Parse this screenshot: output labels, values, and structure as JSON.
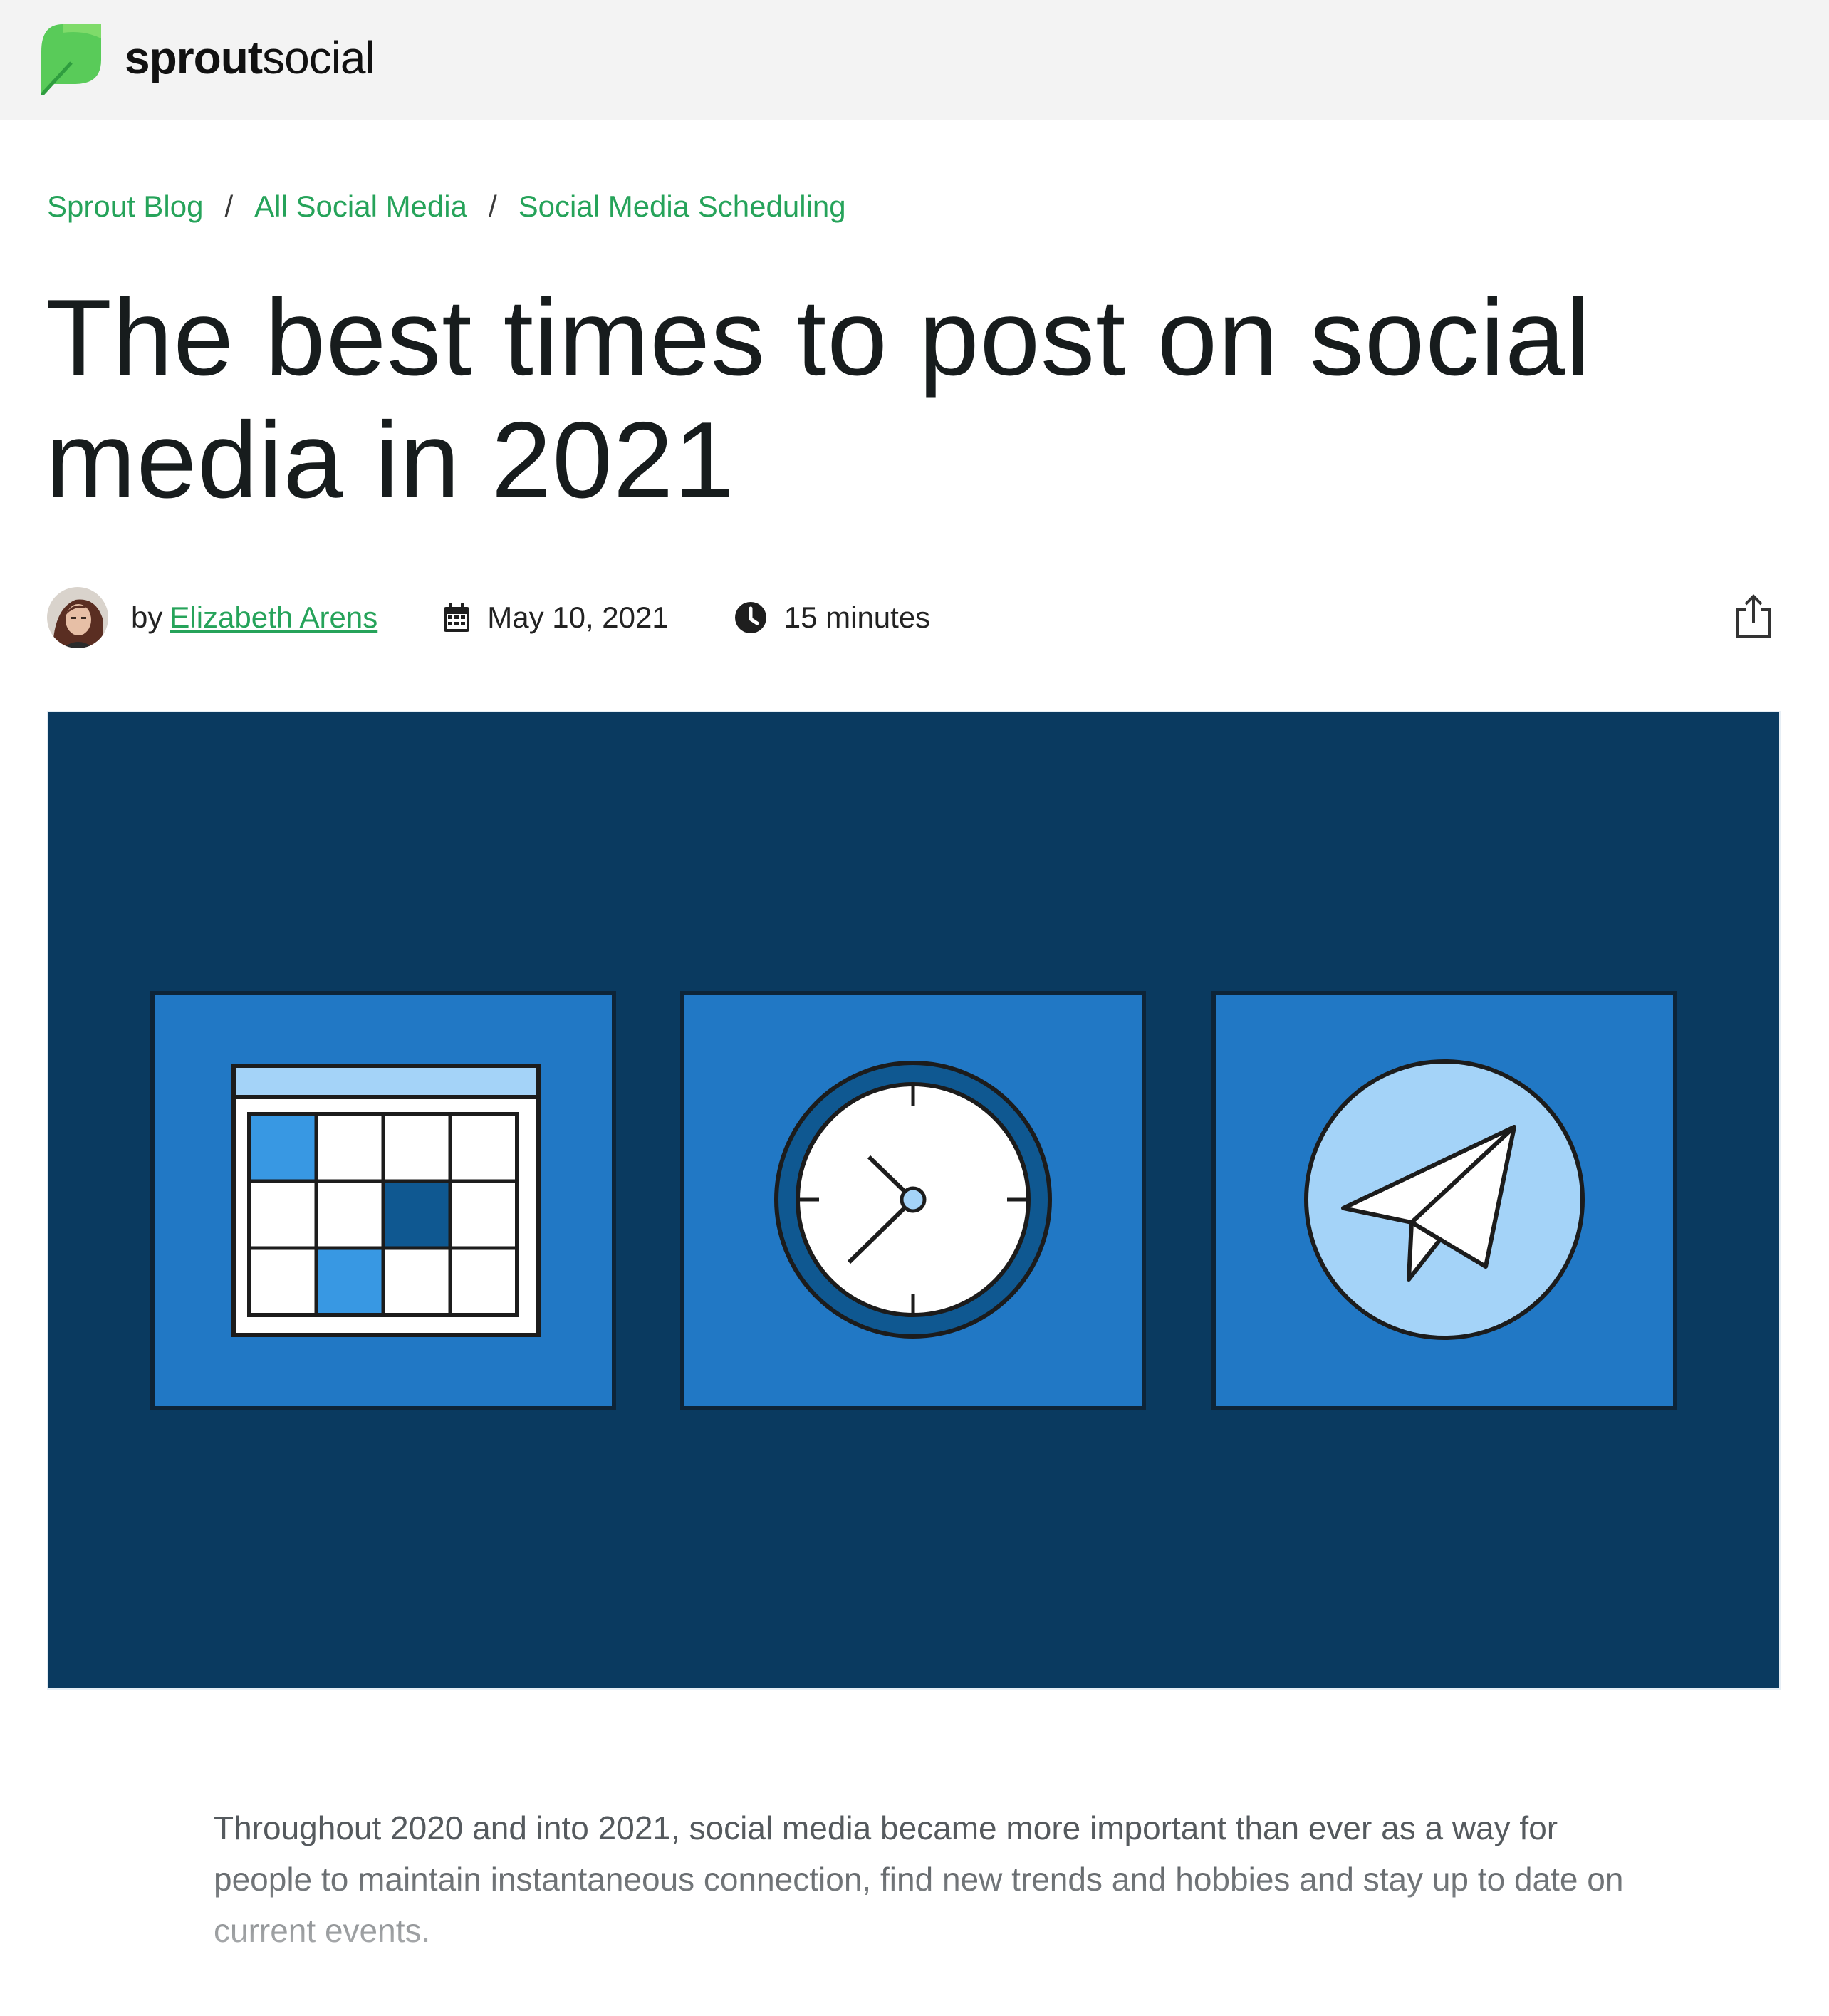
{
  "brand": {
    "name_bold": "sprout",
    "name_light": "social",
    "color": "#59cb59"
  },
  "breadcrumb": {
    "items": [
      "Sprout Blog",
      "All Social Media",
      "Social Media Scheduling"
    ],
    "separator": "/"
  },
  "article": {
    "title": "The best times to post on social media in 2021",
    "by_label": "by",
    "author": "Elizabeth Arens",
    "date": "May 10, 2021",
    "read_time": "15 minutes",
    "intro": "Throughout 2020 and into 2021, social media became more important than ever as a way for people to maintain instantaneous connection, find new trends and hobbies and stay up to date on current events."
  },
  "icons": {
    "logo": "sprout-leaf-icon",
    "calendar": "calendar-icon",
    "clock": "clock-icon",
    "share": "share-icon"
  },
  "colors": {
    "accent": "#26a35a",
    "hero_background": "#0a3a60",
    "hero_tile": "#2178c5",
    "header_background": "#f3f3f3"
  }
}
